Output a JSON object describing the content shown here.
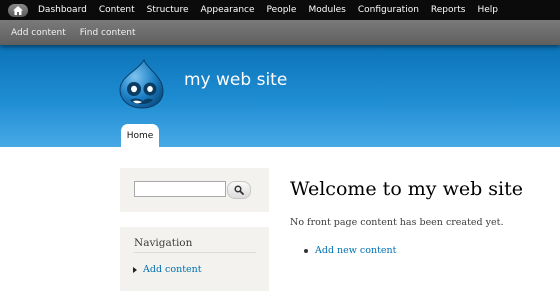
{
  "toolbar": {
    "home_icon": "home-icon",
    "items": [
      {
        "label": "Dashboard"
      },
      {
        "label": "Content"
      },
      {
        "label": "Structure"
      },
      {
        "label": "Appearance"
      },
      {
        "label": "People"
      },
      {
        "label": "Modules"
      },
      {
        "label": "Configuration"
      },
      {
        "label": "Reports"
      },
      {
        "label": "Help"
      }
    ]
  },
  "shortcuts": {
    "items": [
      {
        "label": "Add content"
      },
      {
        "label": "Find content"
      }
    ]
  },
  "header": {
    "site_name": "my web site",
    "logo_icon": "drupal-drop-logo",
    "tabs": [
      {
        "label": "Home",
        "active": true
      }
    ],
    "colors": {
      "top": "#0c73b8",
      "bottom": "#48a9e6"
    }
  },
  "sidebar": {
    "search": {
      "value": "",
      "button_icon": "magnifier-icon"
    },
    "navigation": {
      "title": "Navigation",
      "items": [
        {
          "label": "Add content"
        }
      ]
    }
  },
  "main": {
    "title": "Welcome to my web site",
    "text": "No front page content has been created yet.",
    "links": [
      {
        "label": "Add new content"
      }
    ]
  },
  "colors": {
    "link": "#0071b3",
    "toolbar_bg": "#0b0b0b",
    "block_bg": "#f3f2ee"
  }
}
